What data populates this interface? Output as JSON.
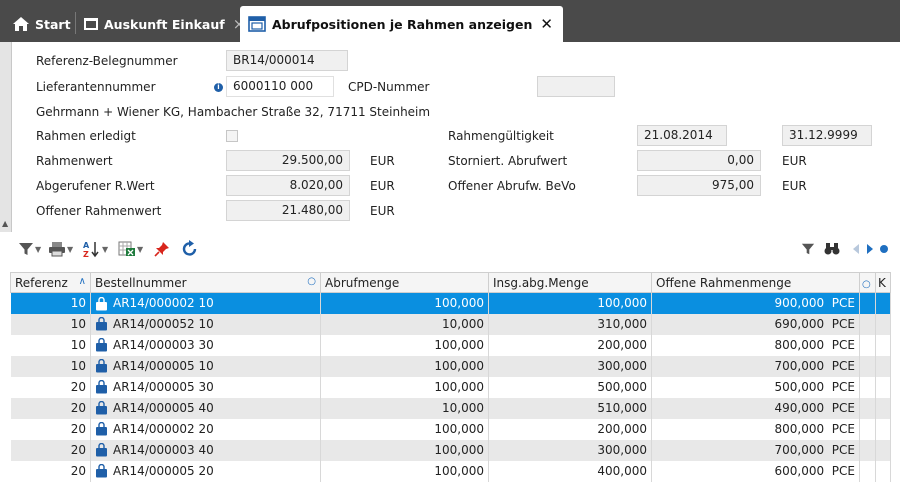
{
  "tabs": [
    {
      "label": "Start"
    },
    {
      "label": "Auskunft Einkauf",
      "close": "×"
    },
    {
      "label": "Abrufpositionen je Rahmen anzeigen",
      "close": "✕"
    }
  ],
  "form": {
    "referenz_label": "Referenz-Belegnummer",
    "referenz_value": "BR14/000014",
    "lieferant_label": "Lieferantennummer",
    "lieferant_value": "6000110 000",
    "cpd_label": "CPD-Nummer",
    "cpd_value": "",
    "address": "Gehrmann + Wiener KG, Hambacher Straße 32, 71711 Steinheim",
    "rahmen_erledigt_label": "Rahmen erledigt",
    "rahmengueltigkeit_label": "Rahmengültigkeit",
    "gueltig_von": "21.08.2014",
    "gueltig_bis": "31.12.9999",
    "rahmenwert_label": "Rahmenwert",
    "rahmenwert_value": "29.500,00",
    "storniert_label": "Storniert. Abrufwert",
    "storniert_value": "0,00",
    "abgerufen_label": "Abgerufener R.Wert",
    "abgerufen_value": "8.020,00",
    "offener_abruf_label": "Offener Abrufw. BeVo",
    "offener_abruf_value": "975,00",
    "offener_rahmen_label": "Offener Rahmenwert",
    "offener_rahmen_value": "21.480,00",
    "currency": "EUR"
  },
  "grid": {
    "columns": [
      "Referenz",
      "Bestellnummer",
      "Abrufmenge",
      "Insg.abg.Menge",
      "Offene Rahmenmenge",
      "K"
    ],
    "rows": [
      {
        "ref": "10",
        "best": "AR14/000002 10",
        "abruf": "100,000",
        "insg": "100,000",
        "offen": "900,000",
        "unit": "PCE"
      },
      {
        "ref": "10",
        "best": "AR14/000052 10",
        "abruf": "10,000",
        "insg": "310,000",
        "offen": "690,000",
        "unit": "PCE"
      },
      {
        "ref": "10",
        "best": "AR14/000003 30",
        "abruf": "100,000",
        "insg": "200,000",
        "offen": "800,000",
        "unit": "PCE"
      },
      {
        "ref": "10",
        "best": "AR14/000005 10",
        "abruf": "100,000",
        "insg": "300,000",
        "offen": "700,000",
        "unit": "PCE"
      },
      {
        "ref": "20",
        "best": "AR14/000005 30",
        "abruf": "100,000",
        "insg": "500,000",
        "offen": "500,000",
        "unit": "PCE"
      },
      {
        "ref": "20",
        "best": "AR14/000005 40",
        "abruf": "10,000",
        "insg": "510,000",
        "offen": "490,000",
        "unit": "PCE"
      },
      {
        "ref": "20",
        "best": "AR14/000002 20",
        "abruf": "100,000",
        "insg": "200,000",
        "offen": "800,000",
        "unit": "PCE"
      },
      {
        "ref": "20",
        "best": "AR14/000003 40",
        "abruf": "100,000",
        "insg": "300,000",
        "offen": "700,000",
        "unit": "PCE"
      },
      {
        "ref": "20",
        "best": "AR14/000005 20",
        "abruf": "100,000",
        "insg": "400,000",
        "offen": "600,000",
        "unit": "PCE"
      }
    ]
  },
  "colors": {
    "accent": "#0a8fe0",
    "tabbar": "#4a4a4a",
    "icon_blue": "#1f5fa8",
    "pin_red": "#d8261c"
  }
}
